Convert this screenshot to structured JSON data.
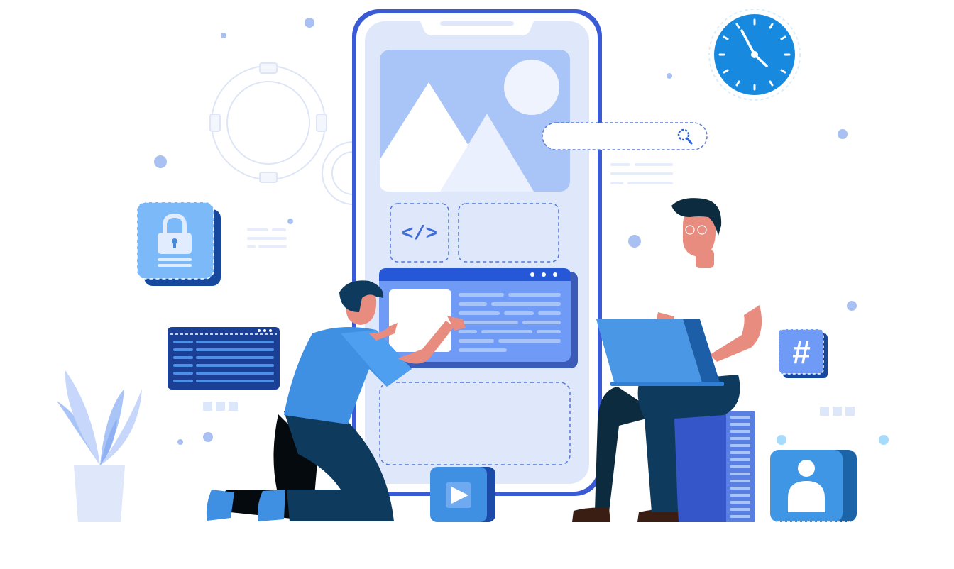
{
  "illustration": {
    "symbols": {
      "code_tag": "</>",
      "hashtag": "#"
    },
    "icons": [
      "gear-icon",
      "lock-icon",
      "search-icon",
      "clock-icon",
      "code-icon",
      "hashtag-icon",
      "play-icon",
      "user-icon",
      "plant-icon",
      "laptop-icon"
    ],
    "colors": {
      "primary_blue": "#3f8fe3",
      "dark_blue": "#0e3a5e",
      "phone_frame": "#3b5bd6",
      "phone_screen": "#dfe7fb",
      "image_card": "#a9c4f7",
      "clock_face": "#178ae0",
      "skin": "#e88c80",
      "navy_card": "#1c3f96",
      "server_blue": "#3456c9"
    }
  }
}
